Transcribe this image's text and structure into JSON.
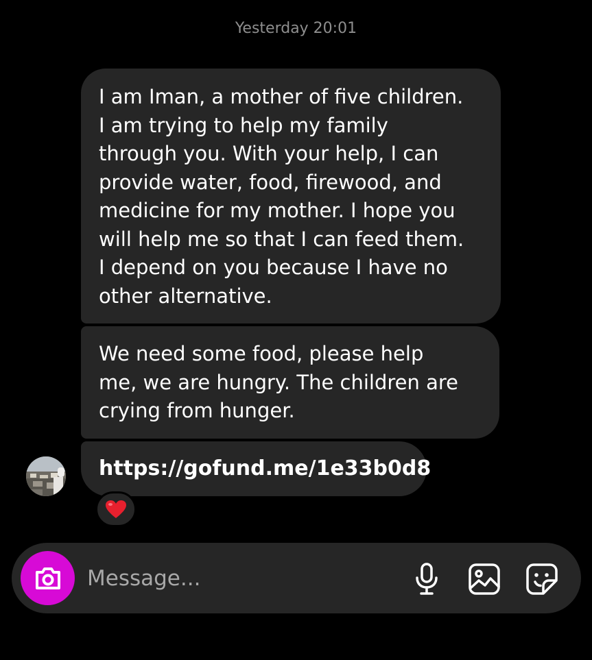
{
  "thread": {
    "timestamp": "Yesterday 20:01",
    "messages": [
      {
        "text": "I am Iman, a mother of five children.\nI am trying to help my family\nthrough you. With your help, I can\nprovide water, food, firewood, and\nmedicine for my mother. I hope you\nwill help me so that I can feed them.\nI depend on you because I have no\nother alternative."
      },
      {
        "text": "We need some food, please help\nme, we are hungry. The children are\ncrying from hunger."
      },
      {
        "text": "https://gofund.me/1e33b0d8",
        "reaction": "❤️"
      }
    ]
  },
  "composer": {
    "placeholder": "Message...",
    "icons": {
      "camera": "camera-icon",
      "mic": "microphone-icon",
      "gallery": "image-icon",
      "sticker": "sticker-icon"
    },
    "camera_color": "#d70ad6"
  },
  "colors": {
    "background": "#000000",
    "bubble": "#262626",
    "timestamp": "#8e8e8e"
  }
}
